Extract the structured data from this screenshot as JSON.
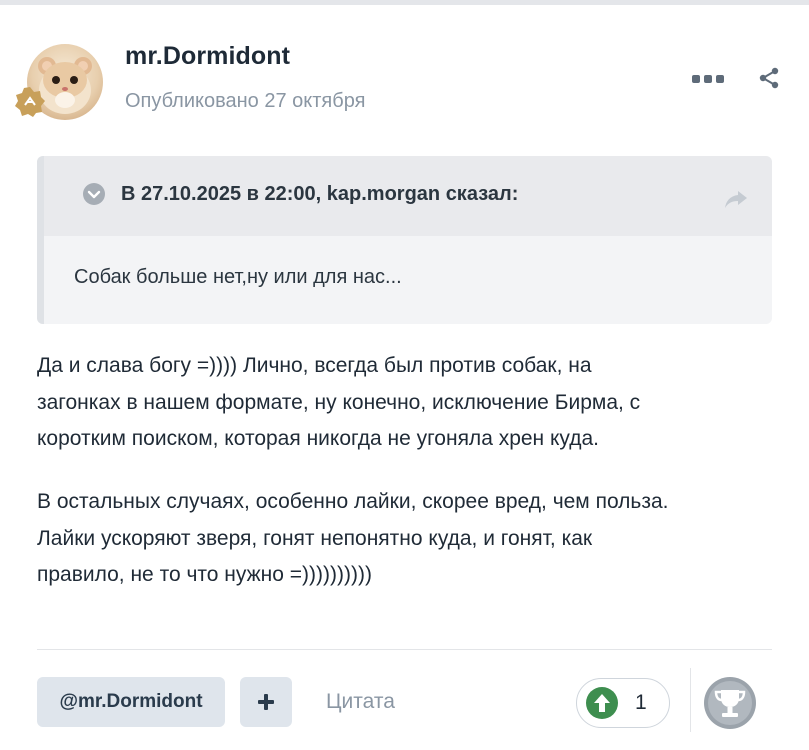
{
  "post": {
    "author": "mr.Dormidont",
    "published_prefix": "Опубликовано",
    "published_date": "27 октября"
  },
  "quote": {
    "citation": "В 27.10.2025 в 22:00, kap.morgan сказал:",
    "text": "Собак больше нет,ну или для нас..."
  },
  "body": {
    "paragraph1": [
      "Да и слава богу =))))  Лично, всегда был против собак, на",
      "загонках в нашем формате, ну конечно, исключение Бирма, с",
      "коротким поиском, которая никогда не угоняла хрен куда."
    ],
    "paragraph2": [
      "В остальных случаях, особенно лайки, скорее вред, чем польза.",
      "Лайки ускоряют зверя, гонят непонятно куда, и гонят, как",
      "правило, не то что нужно =))))))))))"
    ]
  },
  "footer": {
    "mention_label": "@mr.Dormidont",
    "plus_label": "+",
    "quote_label": "Цитата",
    "reaction_count": "1"
  },
  "colors": {
    "accent": "#2a3b4c",
    "upvote_green": "#3e8e4f",
    "muted_text": "#8a96a3",
    "quote_bg": "#f3f4f6"
  },
  "icons": [
    "more-options-icon",
    "share-icon",
    "quote-toggle-icon",
    "quote-share-icon",
    "upvote-icon",
    "trophy-icon",
    "rank-badge-icon"
  ]
}
